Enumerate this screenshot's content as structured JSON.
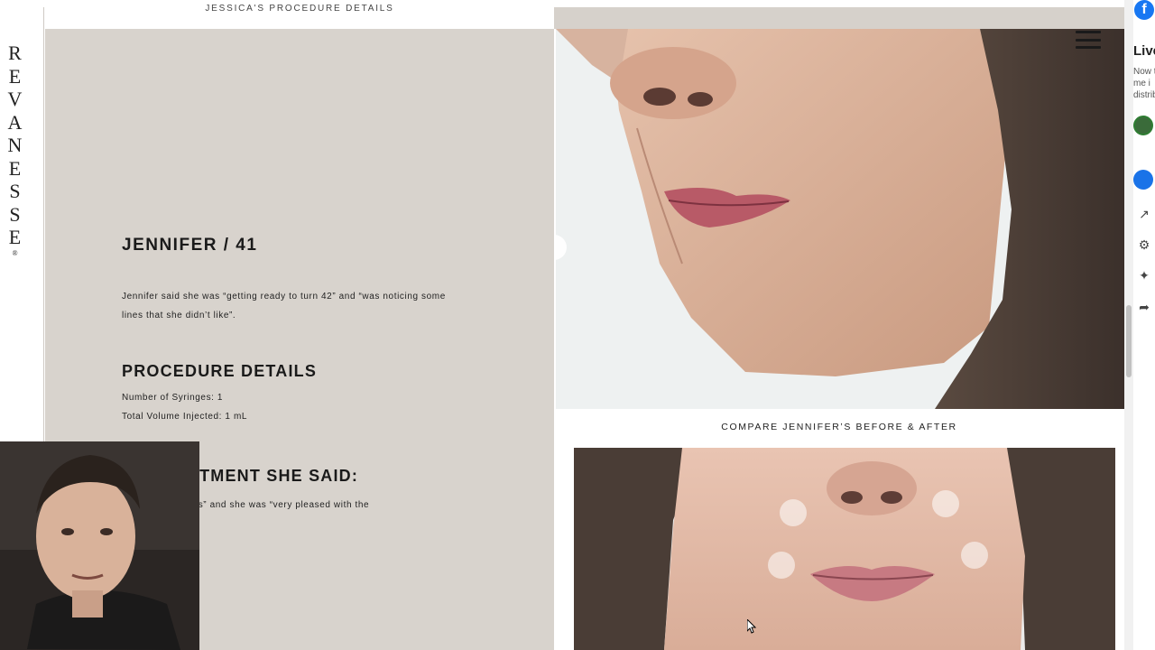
{
  "brand": {
    "letters": [
      "R",
      "E",
      "V",
      "A",
      "N",
      "E",
      "S",
      "S",
      "E"
    ],
    "registered": "®"
  },
  "header": {
    "breadcrumb": "JESSICA'S PROCEDURE DETAILS"
  },
  "patient": {
    "title": "JENNIFER / 41",
    "quote_line1": "Jennifer said she was “getting ready to turn 42” and “was noticing some",
    "quote_line2": "lines that she didn’t like”."
  },
  "procedure": {
    "heading": "PROCEDURE DETAILS",
    "syringes": "Number of Syringes: 1",
    "volume": "Total Volume Injected: 1 mL"
  },
  "after": {
    "heading_visible": "ER TREATMENT SHE SAID:",
    "text_visible": "on a regular basis” and she was “very pleased with the"
  },
  "photos": {
    "compare_label": "COMPARE JENNIFER’S BEFORE & AFTER",
    "menu_icon": "hamburger-menu-icon"
  },
  "side_panel": {
    "facebook_icon": "facebook-icon",
    "live_label": "Live",
    "line1": "Now t",
    "line2": "me i",
    "line3": "distrib"
  },
  "colors": {
    "beige": "#d8d3cd",
    "text_dark": "#1a1a1a",
    "facebook_blue": "#1877f2"
  }
}
